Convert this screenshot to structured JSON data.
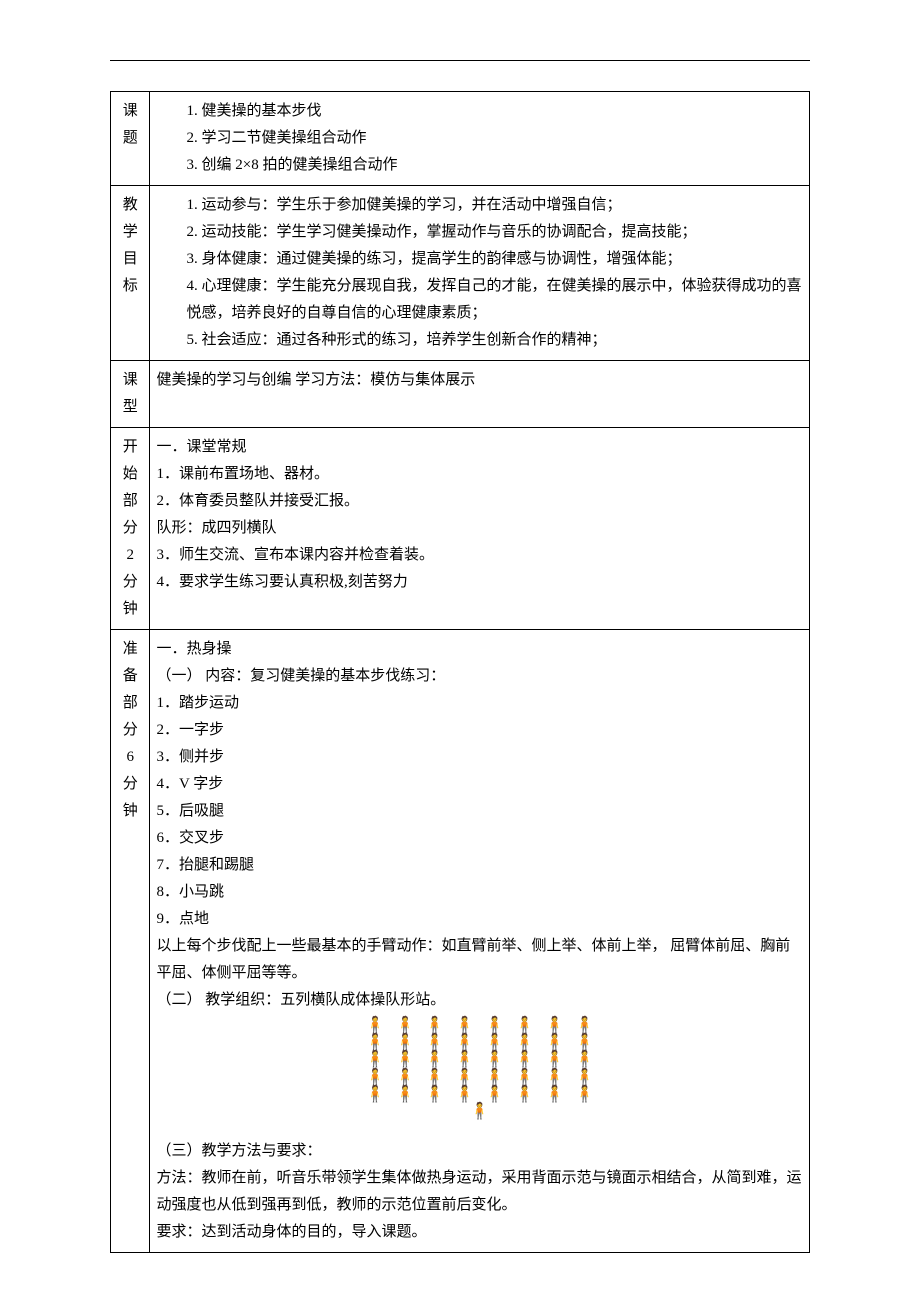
{
  "labels": {
    "topic": [
      "课",
      "题"
    ],
    "objectives": [
      "教",
      "学",
      "目",
      "标"
    ],
    "lesson_type": [
      "课",
      "型"
    ],
    "start": [
      "开",
      "始",
      "部",
      "分",
      "",
      "2",
      "分",
      "钟"
    ],
    "prep": [
      "准",
      "备",
      "部",
      "分",
      "",
      "6",
      "分",
      "钟"
    ]
  },
  "topic": {
    "items": [
      "1.    健美操的基本步伐",
      "2.    学习二节健美操组合动作",
      "3.    创编 2×8 拍的健美操组合动作"
    ]
  },
  "objectives": {
    "items": [
      "1.   运动参与：学生乐于参加健美操的学习，并在活动中增强自信；",
      "2.   运动技能：学生学习健美操动作，掌握动作与音乐的协调配合，提高技能；",
      "3.   身体健康：通过健美操的练习，提高学生的韵律感与协调性，增强体能；",
      "4.   心理健康：学生能充分展现自我，发挥自己的才能，在健美操的展示中，体验获得成功的喜悦感，培养良好的自尊自信的心理健康素质；",
      "5.   社会适应：通过各种形式的练习，培养学生创新合作的精神；"
    ]
  },
  "lesson_type": {
    "text": "健美操的学习与创编      学习方法：模仿与集体展示"
  },
  "start": {
    "heading": "一．课堂常规",
    "lines": [
      "1．课前布置场地、器材。",
      "2．体育委员整队并接受汇报。",
      "队形：成四列横队",
      "3．师生交流、宣布本课内容并检查着装。",
      "4．要求学生练习要认真积极,刻苦努力"
    ]
  },
  "prep": {
    "heading": "一．热身操",
    "sec1_title": "（一） 内容：复习健美操的基本步伐练习：",
    "steps": [
      "1．踏步运动",
      "2．一字步",
      "3．侧并步",
      "4．V 字步",
      "5．后吸腿",
      "6．交叉步",
      "7．抬腿和踢腿",
      "8．小马跳",
      "9．点地"
    ],
    "steps_note": "以上每个步伐配上一些最基本的手臂动作：如直臂前举、侧上举、体前上举， 屈臂体前屈、胸前平屈、体侧平屈等等。",
    "sec2_title": "（二） 教学组织：五列横队成体操队形站。",
    "sec3_title": "（三）教学方法与要求：",
    "method": "方法：教师在前，听音乐带领学生集体做热身运动，采用背面示范与镜面示相结合，从简到难，运动强度也从低到强再到低，教师的示范位置前后变化。",
    "requirement": "要求：达到活动身体的目的，导入课题。"
  },
  "icons": {
    "person": "🧍"
  }
}
